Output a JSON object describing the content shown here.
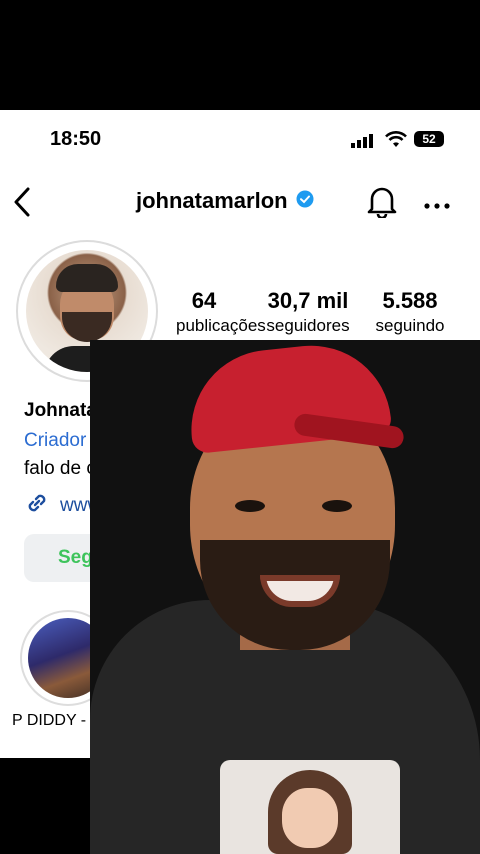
{
  "status_bar": {
    "time": "18:50",
    "battery": "52"
  },
  "nav": {
    "username": "johnatamarlon"
  },
  "stats": [
    {
      "value": "64",
      "label": "publicações"
    },
    {
      "value": "30,7 mil",
      "label": "seguidores"
    },
    {
      "value": "5.588",
      "label": "seguindo"
    }
  ],
  "profile": {
    "name": "Johnata Marlon",
    "category": "Criador de vídeo",
    "bio": "falo de cultura po",
    "link": "www.tiktok.co"
  },
  "actions": {
    "follow_label": "Seguindo"
  },
  "highlights": [
    {
      "label": "P DIDDY -"
    }
  ],
  "colors": {
    "accent_green": "#3ec45c",
    "link_blue": "#1d4e9e",
    "category_blue": "#2b6cd1",
    "verified_blue": "#1e9bf0"
  }
}
